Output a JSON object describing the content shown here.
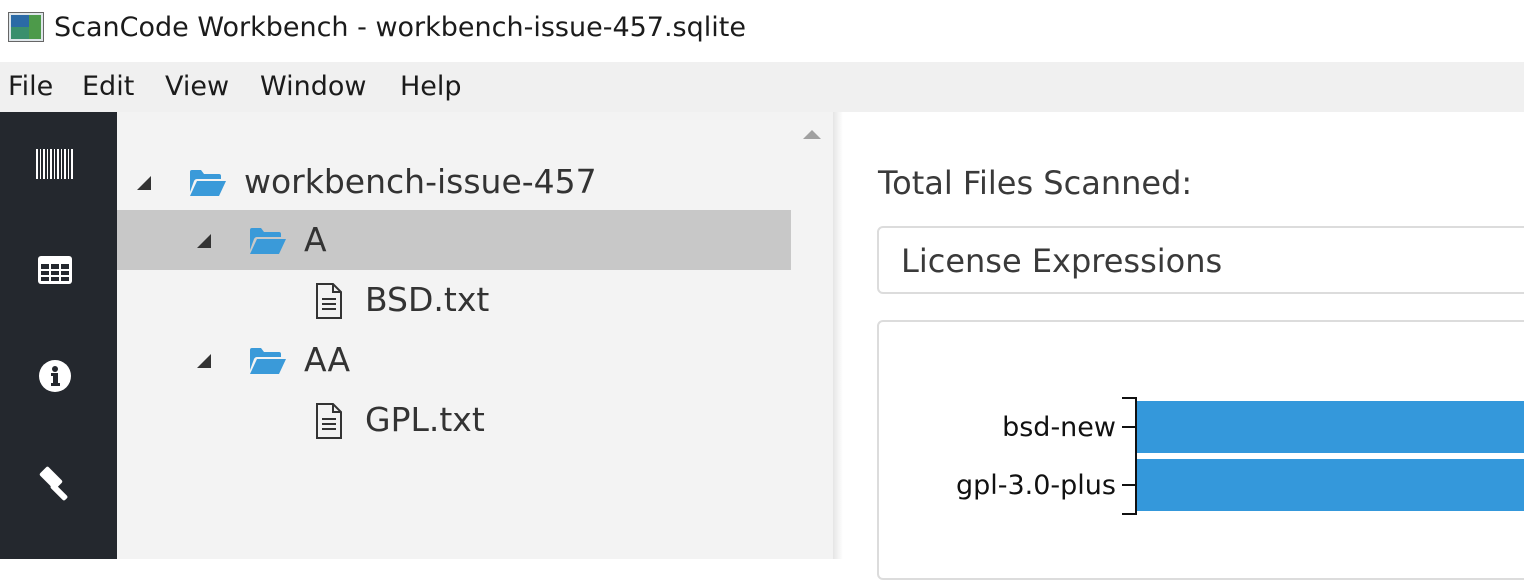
{
  "window": {
    "title": "ScanCode Workbench - workbench-issue-457.sqlite",
    "app_icon": "scancode-app-icon"
  },
  "menu": [
    "File",
    "Edit",
    "View",
    "Window",
    "Help"
  ],
  "nav": [
    {
      "icon": "barcode-icon",
      "name": "scan"
    },
    {
      "icon": "table-icon",
      "name": "table-view"
    },
    {
      "icon": "info-icon",
      "name": "scan-info"
    },
    {
      "icon": "gavel-icon",
      "name": "license-policy"
    }
  ],
  "tree": {
    "root": {
      "label": "workbench-issue-457",
      "type": "folder",
      "expanded": true
    },
    "items": [
      {
        "label": "A",
        "type": "folder",
        "expanded": true,
        "selected": true
      },
      {
        "label": "BSD.txt",
        "type": "file"
      },
      {
        "label": "AA",
        "type": "folder",
        "expanded": true
      },
      {
        "label": "GPL.txt",
        "type": "file"
      }
    ]
  },
  "dashboard": {
    "total_label": "Total Files Scanned:",
    "chart_select": "License Expressions"
  },
  "colors": {
    "bar": "#3498db",
    "folder": "#3a9ad9",
    "nav_bg": "#24282e",
    "selected_row": "#c8c8c8"
  },
  "chart_data": {
    "type": "bar",
    "orientation": "horizontal",
    "categories": [
      "bsd-new",
      "gpl-3.0-plus"
    ],
    "values": [
      1,
      1
    ],
    "title": "",
    "xlabel": "",
    "ylabel": ""
  }
}
